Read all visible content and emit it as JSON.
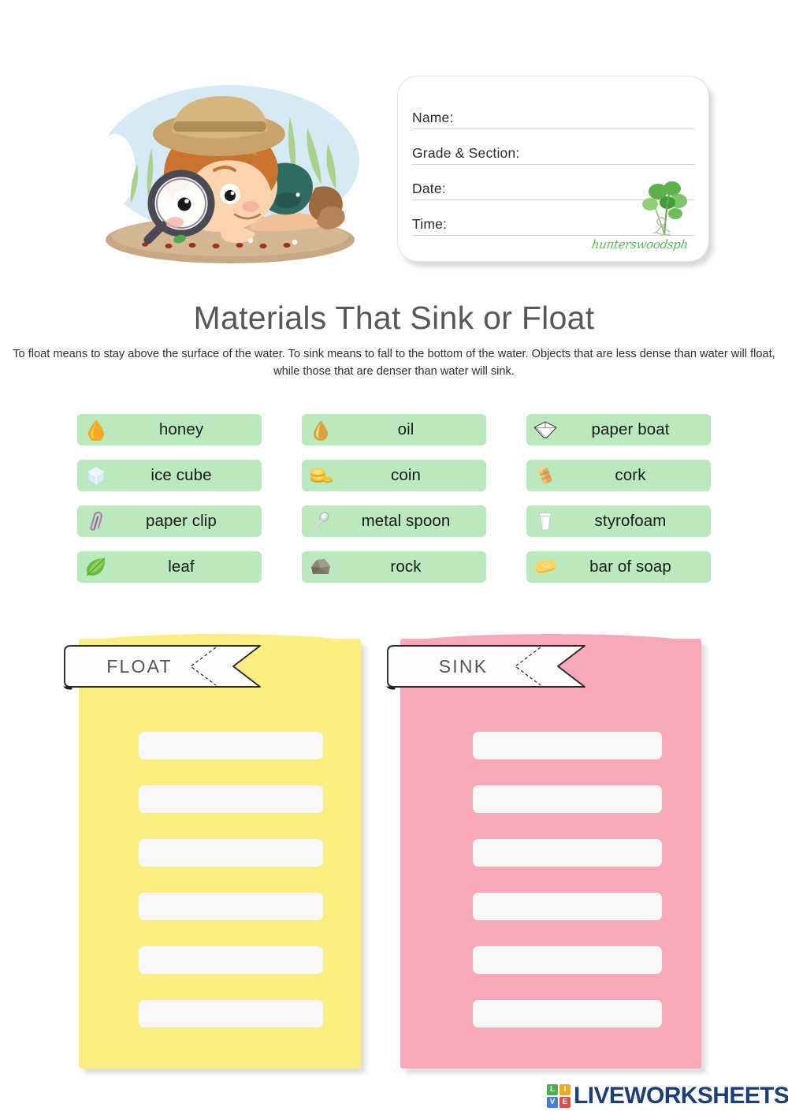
{
  "header": {
    "illustration_name": "boy-with-magnifying-glass-looking-at-ants",
    "name_card": {
      "fields": [
        {
          "label": "Name:"
        },
        {
          "label": "Grade & Section:"
        },
        {
          "label": "Date:"
        },
        {
          "label": "Time:"
        }
      ],
      "signature": "hunterswoodsph",
      "watermark_icon": "plant-with-seated-figure-icon"
    }
  },
  "title": "Materials That Sink or Float",
  "subtitle": "To float means to stay above the surface of the water. To sink means to fall to the bottom of the water. Objects that are less dense than water will float, while those that are denser than water will sink.",
  "word_bank": {
    "chip_color": "#b9e9bc",
    "items": [
      {
        "label": "honey",
        "icon": "honey-drop-icon",
        "column": 1,
        "row": 1
      },
      {
        "label": "oil",
        "icon": "oil-drop-icon",
        "column": 2,
        "row": 1
      },
      {
        "label": "paper boat",
        "icon": "paper-boat-icon",
        "column": 3,
        "row": 1
      },
      {
        "label": "ice cube",
        "icon": "ice-cube-icon",
        "column": 1,
        "row": 2
      },
      {
        "label": "coin",
        "icon": "coin-stack-icon",
        "column": 2,
        "row": 2
      },
      {
        "label": "cork",
        "icon": "cork-icon",
        "column": 3,
        "row": 2
      },
      {
        "label": "paper clip",
        "icon": "paper-clip-icon",
        "column": 1,
        "row": 3
      },
      {
        "label": "metal spoon",
        "icon": "metal-spoon-icon",
        "column": 2,
        "row": 3
      },
      {
        "label": "styrofoam",
        "icon": "styrofoam-cup-icon",
        "column": 3,
        "row": 3
      },
      {
        "label": "leaf",
        "icon": "leaf-icon",
        "column": 1,
        "row": 4
      },
      {
        "label": "rock",
        "icon": "rock-icon",
        "column": 2,
        "row": 4
      },
      {
        "label": "bar of soap",
        "icon": "soap-bar-icon",
        "column": 3,
        "row": 4
      }
    ]
  },
  "sort_cards": [
    {
      "banner_label": "FLOAT",
      "card_color": "#faee81",
      "slot_count": 6,
      "slots": [
        "",
        "",
        "",
        "",
        "",
        ""
      ]
    },
    {
      "banner_label": "SINK",
      "card_color": "#f9a8b8",
      "slot_count": 6,
      "slots": [
        "",
        "",
        "",
        "",
        "",
        ""
      ]
    }
  ],
  "footer": {
    "logo_text": "LIVEWORKSHEETS",
    "logo_color": "#1c3f7c",
    "tiles": [
      {
        "letter": "L",
        "color": "#4caf50"
      },
      {
        "letter": "I",
        "color": "#f5a623"
      },
      {
        "letter": "V",
        "color": "#3f7fd6"
      },
      {
        "letter": "E",
        "color": "#e04c4c"
      }
    ]
  }
}
